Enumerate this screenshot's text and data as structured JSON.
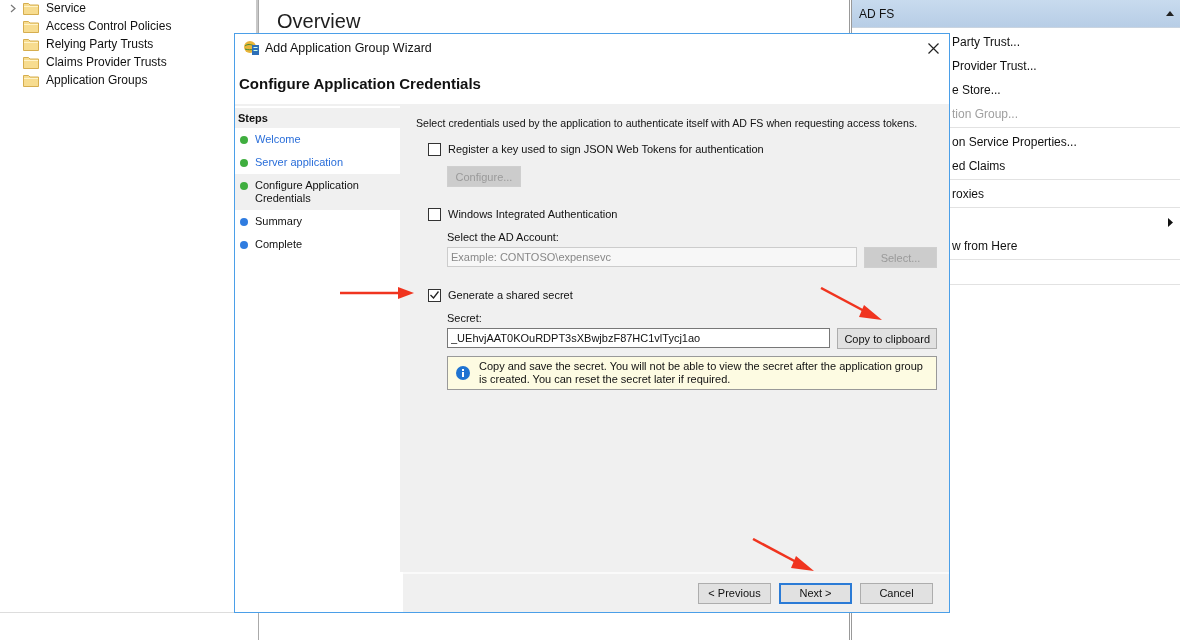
{
  "tree": {
    "items": [
      {
        "label": "Service",
        "expandable": true
      },
      {
        "label": "Access Control Policies",
        "expandable": false
      },
      {
        "label": "Relying Party Trusts",
        "expandable": false
      },
      {
        "label": "Claims Provider Trusts",
        "expandable": false
      },
      {
        "label": "Application Groups",
        "expandable": false
      }
    ]
  },
  "center": {
    "title": "Overview"
  },
  "actions": {
    "title": "AD FS",
    "groups": [
      [
        {
          "label": "Party Trust...",
          "disabled": false,
          "submenu": false
        },
        {
          "label": "Provider Trust...",
          "disabled": false,
          "submenu": false
        },
        {
          "label": "e Store...",
          "disabled": false,
          "submenu": false
        },
        {
          "label": "tion Group...",
          "disabled": true,
          "submenu": false
        }
      ],
      [
        {
          "label": "on Service Properties...",
          "disabled": false,
          "submenu": false
        },
        {
          "label": "ed Claims",
          "disabled": false,
          "submenu": false
        }
      ],
      [
        {
          "label": "roxies",
          "disabled": false,
          "submenu": false
        }
      ],
      [
        {
          "submenu": true,
          "disabled": false
        },
        {
          "label": "w from Here",
          "disabled": false,
          "submenu": false
        }
      ]
    ]
  },
  "dialog": {
    "title": "Add Application Group Wizard",
    "heading": "Configure Application Credentials",
    "steps_title": "Steps",
    "steps": [
      {
        "label": "Welcome",
        "complete": true,
        "selected": false
      },
      {
        "label": "Server application",
        "complete": true,
        "selected": false
      },
      {
        "label": "Configure Application Credentials",
        "complete": true,
        "selected": true
      },
      {
        "label": "Summary",
        "complete": false,
        "selected": false
      },
      {
        "label": "Complete",
        "complete": false,
        "selected": false
      }
    ],
    "intro": "Select credentials used by the application to authenticate itself with AD FS when requesting access tokens.",
    "options": [
      {
        "label": "Register a key used to sign JSON Web Tokens for authentication",
        "checked": false,
        "button": {
          "label": "Configure...",
          "disabled": true
        }
      },
      {
        "label": "Windows Integrated Authentication",
        "checked": false,
        "field_label": "Select the AD Account:",
        "field": {
          "placeholder": "Example: CONTOSO\\expensevc"
        },
        "button": {
          "label": "Select...",
          "disabled": true
        }
      },
      {
        "label": "Generate a shared secret",
        "checked": true,
        "field_label": "Secret:",
        "field": {
          "value": "_UEhvjAAT0KOuRDPT3sXBwjbzF87HC1vlTycj1ao"
        },
        "button": {
          "label": "Copy to clipboard",
          "disabled": false
        },
        "note": "Copy and save the secret.  You will not be able to view the secret after the application group is created.  You can reset the secret later if required."
      }
    ],
    "buttons": [
      {
        "label": "< Previous",
        "default": false
      },
      {
        "label": "Next >",
        "default": true
      },
      {
        "label": "Cancel",
        "default": false
      }
    ]
  }
}
